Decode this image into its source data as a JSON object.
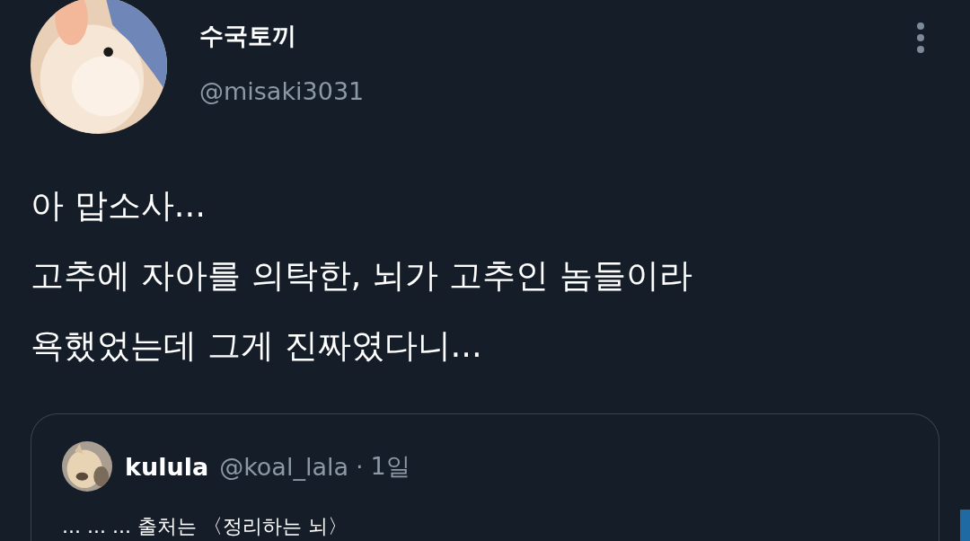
{
  "author": {
    "display_name": "수국토끼",
    "handle": "@misaki3031"
  },
  "tweet_text": [
    "아 맙소사...",
    "고추에 자아를 의탁한, 뇌가 고추인 놈들이라",
    "욕했었는데 그게 진짜였다니..."
  ],
  "quoted_tweet": {
    "display_name": "kulula",
    "handle": "@koal_lala",
    "separator": "·",
    "time": "1일",
    "text": "... ... ... 출처는 〈정리하는 뇌〉"
  }
}
